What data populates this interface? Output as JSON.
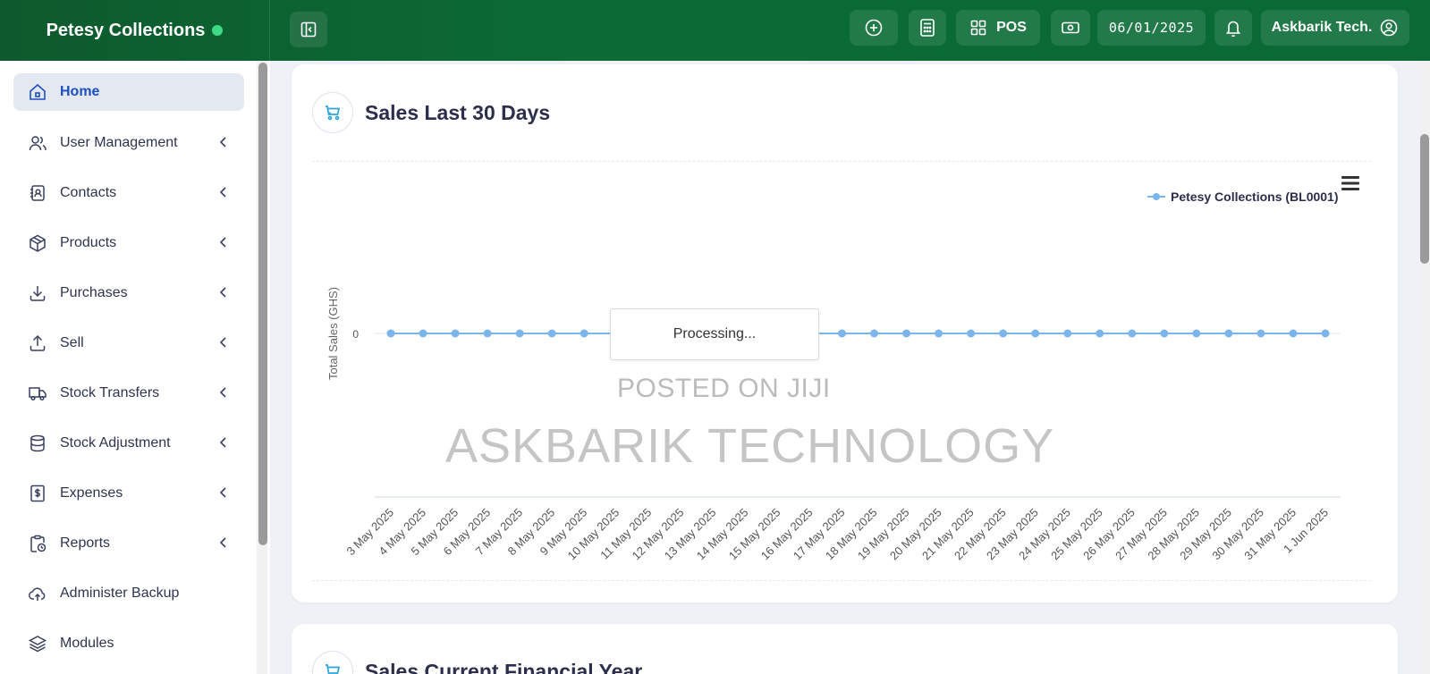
{
  "header": {
    "brand": "Petesy Collections",
    "pos_label": "POS",
    "date": "06/01/2025",
    "user": "Askbarik Tech."
  },
  "sidebar": {
    "items": [
      {
        "label": "Home",
        "icon": "home-icon",
        "active": true
      },
      {
        "label": "User Management",
        "icon": "users-icon"
      },
      {
        "label": "Contacts",
        "icon": "contacts-icon"
      },
      {
        "label": "Products",
        "icon": "box-icon"
      },
      {
        "label": "Purchases",
        "icon": "download-icon"
      },
      {
        "label": "Sell",
        "icon": "upload-icon"
      },
      {
        "label": "Stock Transfers",
        "icon": "truck-icon"
      },
      {
        "label": "Stock Adjustment",
        "icon": "database-icon"
      },
      {
        "label": "Expenses",
        "icon": "receipt-icon"
      },
      {
        "label": "Reports",
        "icon": "clipboard-clock-icon"
      },
      {
        "label": "Administer Backup",
        "icon": "cloud-upload-icon"
      },
      {
        "label": "Modules",
        "icon": "layers-icon"
      }
    ]
  },
  "main": {
    "card1_title": "Sales Last 30 Days",
    "card2_title": "Sales Current Financial Year",
    "processing": "Processing...",
    "watermark_small": "POSTED ON JIJI",
    "watermark_large": "ASKBARIK TECHNOLOGY"
  },
  "colors": {
    "accent": "#0b6b34",
    "active_nav": "#1e4fbf",
    "series": "#7cb5ec"
  },
  "chart_data": {
    "type": "line",
    "ylabel": "Total Sales (GHS)",
    "x": [
      "3 May 2025",
      "4 May 2025",
      "5 May 2025",
      "6 May 2025",
      "7 May 2025",
      "8 May 2025",
      "9 May 2025",
      "10 May 2025",
      "11 May 2025",
      "12 May 2025",
      "13 May 2025",
      "14 May 2025",
      "15 May 2025",
      "16 May 2025",
      "17 May 2025",
      "18 May 2025",
      "19 May 2025",
      "20 May 2025",
      "21 May 2025",
      "22 May 2025",
      "23 May 2025",
      "24 May 2025",
      "25 May 2025",
      "26 May 2025",
      "27 May 2025",
      "28 May 2025",
      "29 May 2025",
      "30 May 2025",
      "31 May 2025",
      "1 Jun 2025"
    ],
    "series": [
      {
        "name": "Petesy Collections (BL0001)",
        "values": [
          0,
          0,
          0,
          0,
          0,
          0,
          0,
          0,
          0,
          0,
          0,
          0,
          0,
          0,
          0,
          0,
          0,
          0,
          0,
          0,
          0,
          0,
          0,
          0,
          0,
          0,
          0,
          0,
          0,
          0
        ]
      }
    ],
    "yticks": [
      "0"
    ],
    "legend": "top-right",
    "grid": true
  }
}
